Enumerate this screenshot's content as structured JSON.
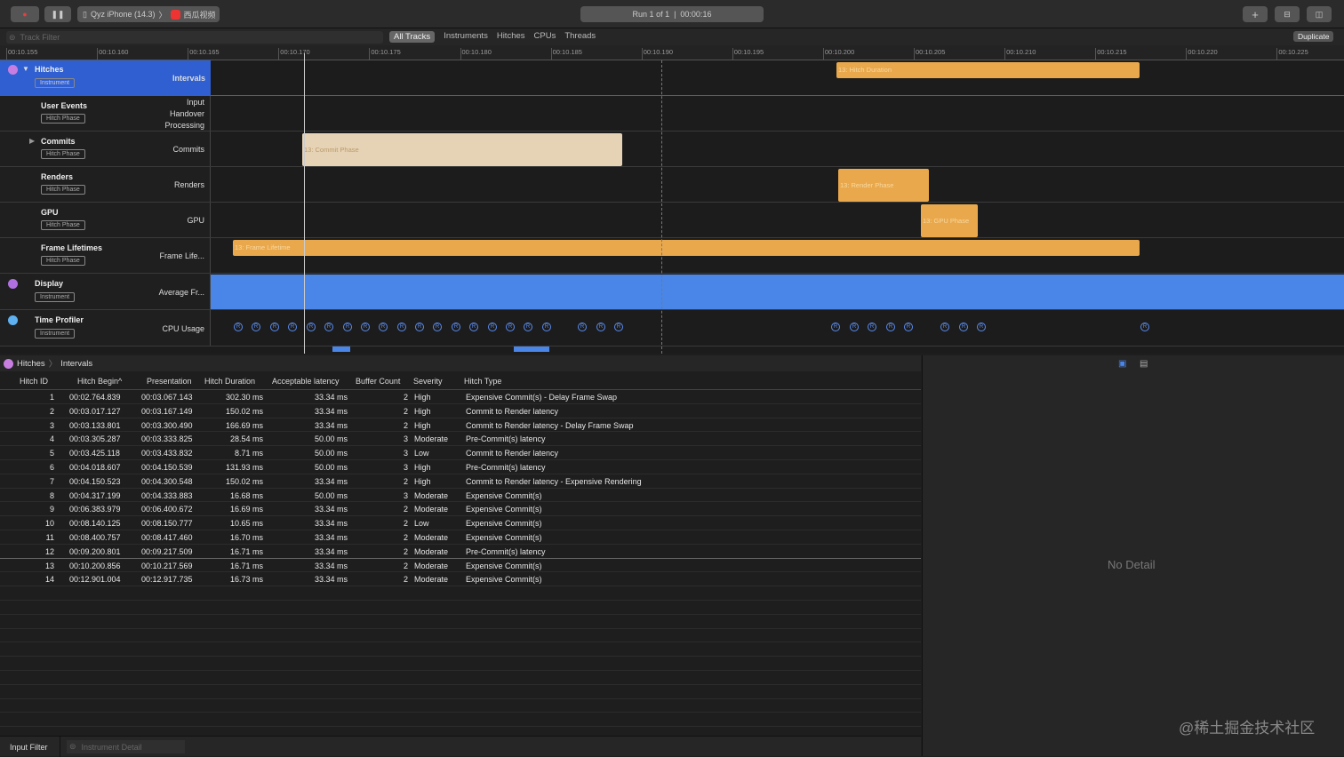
{
  "toolbar": {
    "device": "Qyz iPhone (14.3)",
    "app": "西瓜视频",
    "run": "Run 1 of 1  |  00:00:16",
    "record_icon": "record-icon",
    "pause_icon": "pause-icon"
  },
  "filter": {
    "placeholder": "Track Filter",
    "tabs": [
      "All Tracks",
      "Instruments",
      "Hitches",
      "CPUs",
      "Threads"
    ],
    "active": "All Tracks",
    "duplicate": "Duplicate"
  },
  "ruler": {
    "ticks": [
      "00:10.155",
      "00:10.160",
      "00:10.165",
      "00:10.170",
      "00:10.175",
      "00:10.180",
      "00:10.185",
      "00:10.190",
      "00:10.195",
      "00:10.200",
      "00:10.205",
      "00:10.210",
      "00:10.215",
      "00:10.220",
      "00:10.225"
    ]
  },
  "tracks": {
    "hitches": {
      "name": "Hitches",
      "badge": "Instrument",
      "right": "Intervals",
      "bar": "13: Hitch Duration"
    },
    "user_events": {
      "name": "User Events",
      "badge": "Hitch Phase",
      "right": [
        "Input",
        "Handover",
        "Processing"
      ]
    },
    "commits": {
      "name": "Commits",
      "badge": "Hitch Phase",
      "right": "Commits",
      "bar": "13: Commit Phase"
    },
    "renders": {
      "name": "Renders",
      "badge": "Hitch Phase",
      "right": "Renders",
      "bar": "13: Render Phase"
    },
    "gpu": {
      "name": "GPU",
      "badge": "Hitch Phase",
      "right": "GPU",
      "bar": "13: GPU Phase"
    },
    "frame": {
      "name": "Frame Lifetimes",
      "badge": "Hitch Phase",
      "right": "Frame Life...",
      "bar": "13: Frame Lifetime"
    },
    "display": {
      "name": "Display",
      "badge": "Instrument",
      "right": "Average Fr..."
    },
    "profiler": {
      "name": "Time Profiler",
      "badge": "Instrument",
      "right": "CPU Usage",
      "marker": "R"
    }
  },
  "colors": {
    "accent": "#2f5fd0",
    "hitch_bar": "#e9a84c",
    "commit_bar": "#e6d3b5",
    "display": "#4a86e8"
  },
  "breadcrumb": [
    "Hitches",
    "Intervals"
  ],
  "table": {
    "columns": [
      "Hitch ID",
      "Hitch Begin",
      "Presentation",
      "Hitch Duration",
      "Acceptable latency",
      "Buffer Count",
      "Severity",
      "Hitch Type"
    ],
    "rows": [
      [
        "1",
        "00:02.764.839",
        "00:03.067.143",
        "302.30 ms",
        "33.34 ms",
        "2",
        "High",
        "Expensive Commit(s) - Delay Frame Swap"
      ],
      [
        "2",
        "00:03.017.127",
        "00:03.167.149",
        "150.02 ms",
        "33.34 ms",
        "2",
        "High",
        "Commit to Render latency"
      ],
      [
        "3",
        "00:03.133.801",
        "00:03.300.490",
        "166.69 ms",
        "33.34 ms",
        "2",
        "High",
        "Commit to Render latency - Delay Frame Swap"
      ],
      [
        "4",
        "00:03.305.287",
        "00:03.333.825",
        "28.54 ms",
        "50.00 ms",
        "3",
        "Moderate",
        "Pre-Commit(s) latency"
      ],
      [
        "5",
        "00:03.425.118",
        "00:03.433.832",
        "8.71 ms",
        "50.00 ms",
        "3",
        "Low",
        "Commit to Render latency"
      ],
      [
        "6",
        "00:04.018.607",
        "00:04.150.539",
        "131.93 ms",
        "50.00 ms",
        "3",
        "High",
        "Pre-Commit(s) latency"
      ],
      [
        "7",
        "00:04.150.523",
        "00:04.300.548",
        "150.02 ms",
        "33.34 ms",
        "2",
        "High",
        "Commit to Render latency - Expensive Rendering"
      ],
      [
        "8",
        "00:04.317.199",
        "00:04.333.883",
        "16.68 ms",
        "50.00 ms",
        "3",
        "Moderate",
        "Expensive Commit(s)"
      ],
      [
        "9",
        "00:06.383.979",
        "00:06.400.672",
        "16.69 ms",
        "33.34 ms",
        "2",
        "Moderate",
        "Expensive Commit(s)"
      ],
      [
        "10",
        "00:08.140.125",
        "00:08.150.777",
        "10.65 ms",
        "33.34 ms",
        "2",
        "Low",
        "Expensive Commit(s)"
      ],
      [
        "11",
        "00:08.400.757",
        "00:08.417.460",
        "16.70 ms",
        "33.34 ms",
        "2",
        "Moderate",
        "Expensive Commit(s)"
      ],
      [
        "12",
        "00:09.200.801",
        "00:09.217.509",
        "16.71 ms",
        "33.34 ms",
        "2",
        "Moderate",
        "Pre-Commit(s) latency"
      ],
      [
        "13",
        "00:10.200.856",
        "00:10.217.569",
        "16.71 ms",
        "33.34 ms",
        "2",
        "Moderate",
        "Expensive Commit(s)"
      ],
      [
        "14",
        "00:12.901.004",
        "00:12.917.735",
        "16.73 ms",
        "33.34 ms",
        "2",
        "Moderate",
        "Expensive Commit(s)"
      ]
    ]
  },
  "detail": {
    "empty": "No Detail"
  },
  "bottom": {
    "input_filter": "Input Filter",
    "detail_placeholder": "Instrument Detail"
  },
  "watermark": "@稀土掘金技术社区"
}
